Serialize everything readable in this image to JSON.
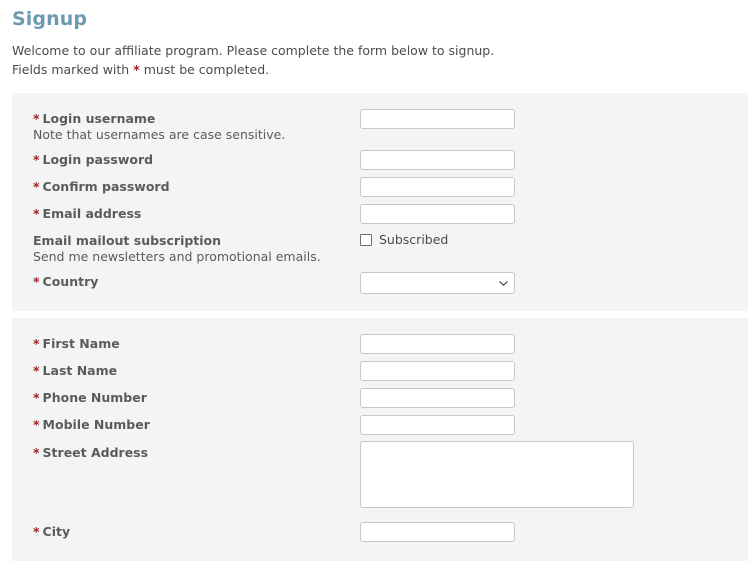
{
  "header": {
    "title": "Signup",
    "intro_line1": "Welcome to our affiliate program. Please complete the form below to signup.",
    "intro_line2_before": "Fields marked with ",
    "intro_required_marker": "*",
    "intro_line2_after": " must be completed."
  },
  "required_marker": "*",
  "account_section": {
    "username": {
      "label": "Login username",
      "hint": "Note that usernames are case sensitive.",
      "value": "",
      "placeholder": ""
    },
    "password": {
      "label": "Login password",
      "value": "",
      "placeholder": ""
    },
    "confirm_password": {
      "label": "Confirm password",
      "value": "",
      "placeholder": ""
    },
    "email": {
      "label": "Email address",
      "value": "",
      "placeholder": ""
    },
    "subscription": {
      "label": "Email mailout subscription",
      "hint": "Send me newsletters and promotional emails.",
      "checkbox_label": "Subscribed",
      "checked": false
    },
    "country": {
      "label": "Country",
      "selected": "",
      "options": [
        ""
      ]
    }
  },
  "contact_section": {
    "first_name": {
      "label": "First Name",
      "value": "",
      "placeholder": ""
    },
    "last_name": {
      "label": "Last Name",
      "value": "",
      "placeholder": ""
    },
    "phone_number": {
      "label": "Phone Number",
      "value": "",
      "placeholder": ""
    },
    "mobile_number": {
      "label": "Mobile Number",
      "value": "",
      "placeholder": ""
    },
    "street_address": {
      "label": "Street Address",
      "value": "",
      "placeholder": ""
    },
    "city": {
      "label": "City",
      "value": "",
      "placeholder": ""
    }
  },
  "colors": {
    "heading": "#6b9ab1",
    "panel_background": "#f3f4f6",
    "required_star": "#a32020",
    "label_text": "#5b5b5b",
    "input_border": "#c8c8c8"
  }
}
